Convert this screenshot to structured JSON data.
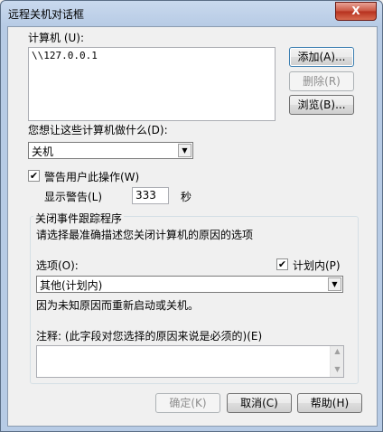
{
  "window": {
    "title": "远程关机对话框",
    "close_glyph": "X"
  },
  "computers": {
    "label": "计算机 (U):",
    "items": [
      "\\\\127.0.0.1"
    ]
  },
  "buttons": {
    "add": "添加(A)...",
    "delete": "删除(R)",
    "browse": "浏览(B)...",
    "ok": "确定(K)",
    "cancel": "取消(C)",
    "help": "帮助(H)"
  },
  "action": {
    "label": "您想让这些计算机做什么(D):",
    "selected": "关机"
  },
  "warn": {
    "label": "警告用户此操作(W)",
    "checked": true,
    "display_label": "显示警告(L)",
    "seconds_value": "333",
    "seconds_unit": "秒"
  },
  "tracker": {
    "group_title": "关闭事件跟踪程序",
    "description": "请选择最准确描述您关闭计算机的原因的选项",
    "option_label": "选项(O):",
    "planned_label": "计划内(P)",
    "planned_checked": true,
    "option_selected": "其他(计划内)",
    "reason_text": "因为未知原因而重新启动或关机。",
    "comment_label": "注释: (此字段对您选择的原因来说是必须的)(E)"
  }
}
